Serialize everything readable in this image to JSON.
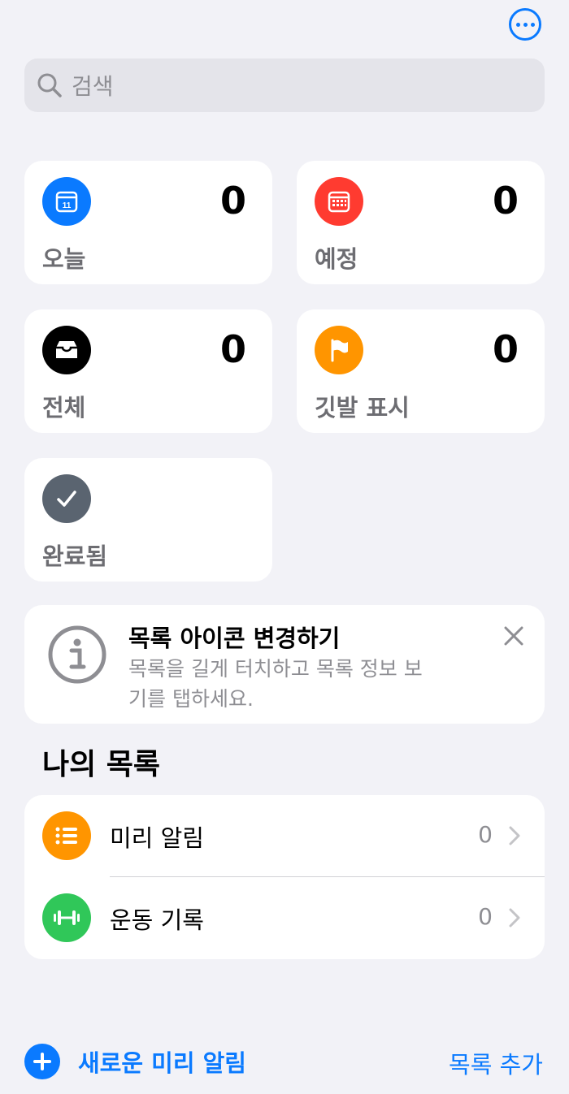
{
  "header": {
    "more_icon": "ellipsis-circle-icon"
  },
  "search": {
    "placeholder": "검색",
    "icon": "magnifier-icon"
  },
  "smart_lists": [
    {
      "label": "오늘",
      "count": "0",
      "icon": "calendar-11-icon",
      "color": "#0a7aff"
    },
    {
      "label": "예정",
      "count": "0",
      "icon": "calendar-grid-icon",
      "color": "#ff3b30"
    },
    {
      "label": "전체",
      "count": "0",
      "icon": "tray-icon",
      "color": "#000000"
    },
    {
      "label": "깃발 표시",
      "count": "0",
      "icon": "flag-icon",
      "color": "#ff9500"
    },
    {
      "label": "완료됨",
      "count": "",
      "icon": "checkmark-icon",
      "color": "#5a6470"
    }
  ],
  "tip": {
    "title": "목록 아이콘 변경하기",
    "body": "목록을 길게 터치하고 목록 정보 보기를 탭하세요.",
    "icon": "info-circle-icon",
    "close_icon": "close-icon"
  },
  "my_lists": {
    "title": "나의 목록",
    "items": [
      {
        "name": "미리 알림",
        "count": "0",
        "icon": "list-bullet-icon",
        "color": "#ff9500"
      },
      {
        "name": "운동 기록",
        "count": "0",
        "icon": "dumbbell-icon",
        "color": "#30c759"
      }
    ]
  },
  "footer": {
    "new_reminder": "새로운 미리 알림",
    "add_list": "목록 추가"
  },
  "colors": {
    "accent": "#0a7aff",
    "background": "#f2f2f7"
  }
}
